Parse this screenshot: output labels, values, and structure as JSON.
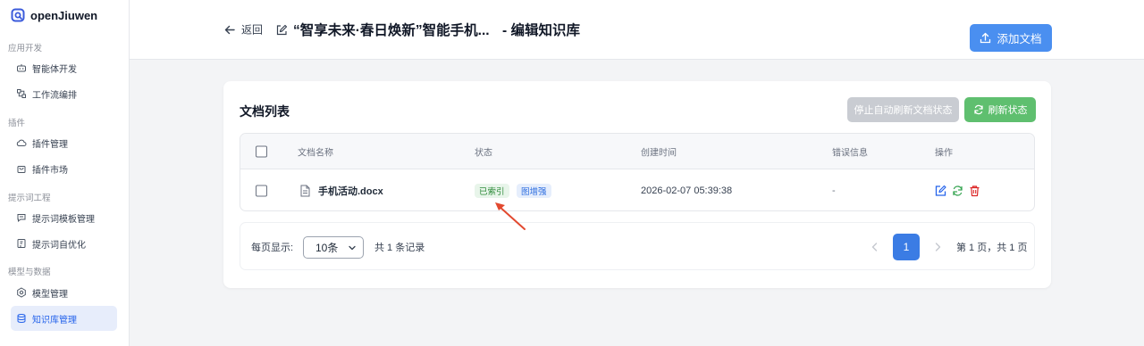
{
  "app": {
    "name": "openJiuwen",
    "accent": "#2563eb"
  },
  "sidebar": {
    "sections": [
      {
        "label": "应用开发",
        "items": [
          {
            "label": "智能体开发",
            "icon": "robot-icon"
          },
          {
            "label": "工作流编排",
            "icon": "workflow-icon"
          }
        ]
      },
      {
        "label": "插件",
        "items": [
          {
            "label": "插件管理",
            "icon": "cloud-icon"
          },
          {
            "label": "插件市场",
            "icon": "shopping-bag-icon"
          }
        ]
      },
      {
        "label": "提示词工程",
        "items": [
          {
            "label": "提示词模板管理",
            "icon": "chat-icon"
          },
          {
            "label": "提示词自优化",
            "icon": "prompt-optimize-icon"
          }
        ]
      },
      {
        "label": "模型与数据",
        "items": [
          {
            "label": "模型管理",
            "icon": "hexagon-gear-icon"
          },
          {
            "label": "知识库管理",
            "icon": "database-icon",
            "active": true
          }
        ]
      }
    ]
  },
  "header": {
    "back_label": "返回",
    "title": "“智享未来·春日焕新”智能手机...",
    "title_suffix": "- 编辑知识库",
    "add_doc_label": "添加文档"
  },
  "card": {
    "title": "文档列表",
    "stop_refresh_label": "停止自动刷新文档状态",
    "refresh_label": "刷新状态",
    "columns": [
      "文档名称",
      "状态",
      "创建时间",
      "错误信息",
      "操作"
    ],
    "rows": [
      {
        "name": "手机活动.docx",
        "status_badges": [
          "已索引",
          "图增强"
        ],
        "created": "2026-02-07 05:39:38",
        "error": "-",
        "actions": [
          "edit-icon",
          "refresh-icon",
          "trash-icon"
        ]
      }
    ]
  },
  "pagination": {
    "per_page_label": "每页显示:",
    "per_page_value": "10条",
    "total_label": "共 1 条记录",
    "current_page": "1",
    "page_info": "第 1 页，共 1 页"
  }
}
